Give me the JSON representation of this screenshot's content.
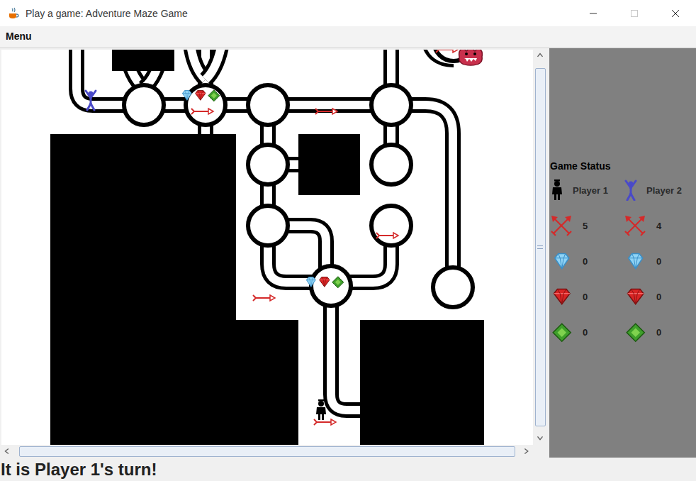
{
  "window": {
    "title": "Play a game: Adventure Maze Game"
  },
  "menu_bar": {
    "items": [
      "Menu"
    ]
  },
  "scrollbars": {
    "vertical": {
      "level": 0.97
    },
    "horizontal": {
      "level": 0.98
    }
  },
  "status_panel": {
    "heading": "Game Status",
    "players": [
      {
        "name": "Player 1",
        "kind": "standing",
        "color": "#000000",
        "arrows": "5",
        "diamonds": "0",
        "rubies": "0",
        "emeralds": "0"
      },
      {
        "name": "Player 2",
        "kind": "cheering",
        "color": "#4a4ac8",
        "arrows": "4",
        "diamonds": "0",
        "rubies": "0",
        "emeralds": "0"
      }
    ]
  },
  "status_bar": "It is Player 1's turn!"
}
